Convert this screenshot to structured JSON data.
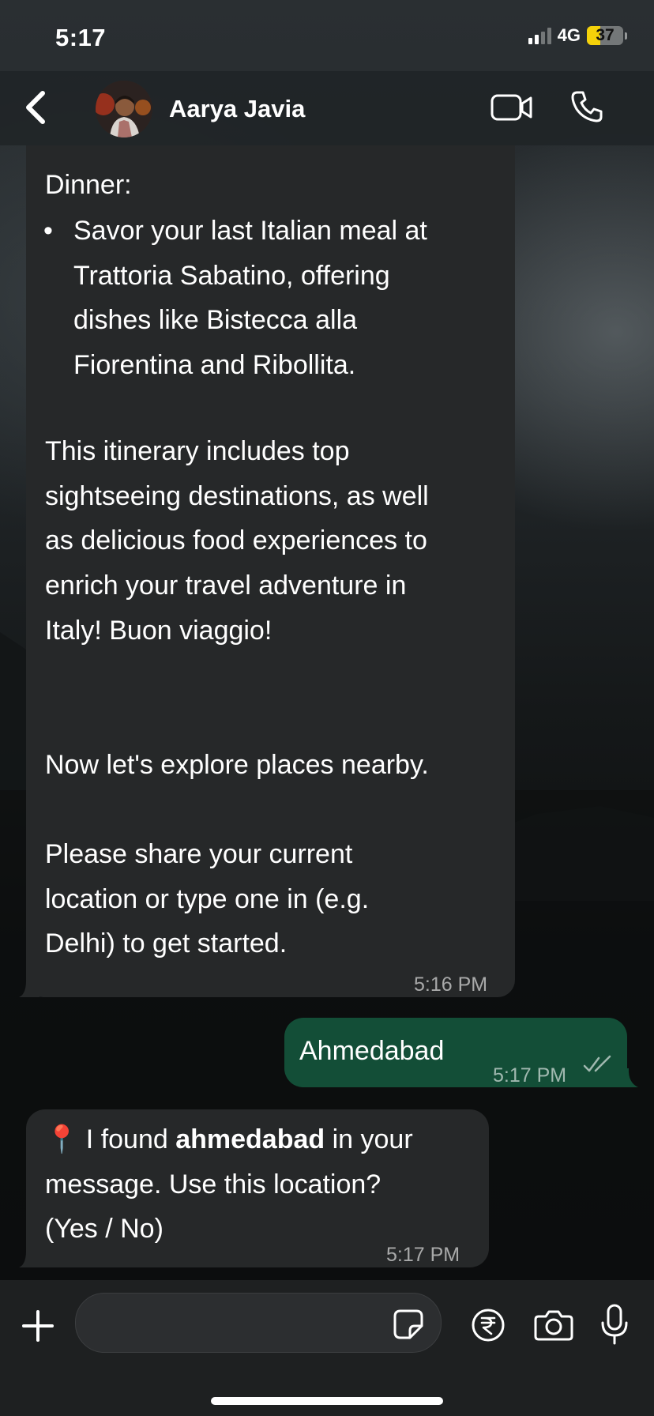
{
  "status_bar": {
    "time": "5:17",
    "network": "4G",
    "battery": "37",
    "battery_level_percent": 37,
    "battery_color": "#f5d20a"
  },
  "header": {
    "contact_name": "Aarya Javia",
    "back_icon": "chevron-left-icon",
    "video_icon": "video-camera-icon",
    "call_icon": "phone-icon"
  },
  "messages": [
    {
      "direction": "incoming",
      "label": "Dinner:",
      "bullet": "•",
      "bullet_lines": [
        "Savor your last Italian meal at",
        "Trattoria Sabatino, offering",
        "dishes like Bistecca alla",
        "Fiorentina and Ribollita."
      ],
      "closing_lines": [
        "This itinerary includes top",
        "sightseeing destinations, as well",
        "as delicious food experiences to",
        "enrich your travel adventure in",
        "Italy! Buon viaggio!"
      ],
      "explore_line": "Now let's explore places nearby.",
      "prompt_lines": [
        "Please share your current",
        "location or type one in (e.g.",
        "Delhi) to get started."
      ],
      "time": "5:16 PM"
    },
    {
      "direction": "outgoing",
      "text": "Ahmedabad",
      "time": "5:17 PM",
      "status_icon": "double-check-icon"
    },
    {
      "direction": "incoming",
      "emoji": "📍",
      "line1_before": "I found ",
      "line1_bold": "ahmedabad",
      "line1_after": " in your",
      "line2": "message. Use this location?",
      "line3": "(Yes / No)",
      "time": "5:17 PM"
    }
  ],
  "composer": {
    "plus_icon": "plus-icon",
    "sticker_icon": "sticker-icon",
    "rupee_icon": "rupee-payment-icon",
    "camera_icon": "camera-icon",
    "mic_icon": "microphone-icon",
    "input_value": ""
  },
  "colors": {
    "incoming_bubble": "#262829",
    "outgoing_bubble": "#134e37",
    "header_bg": "#202426",
    "composer_bg": "#1e2021"
  }
}
